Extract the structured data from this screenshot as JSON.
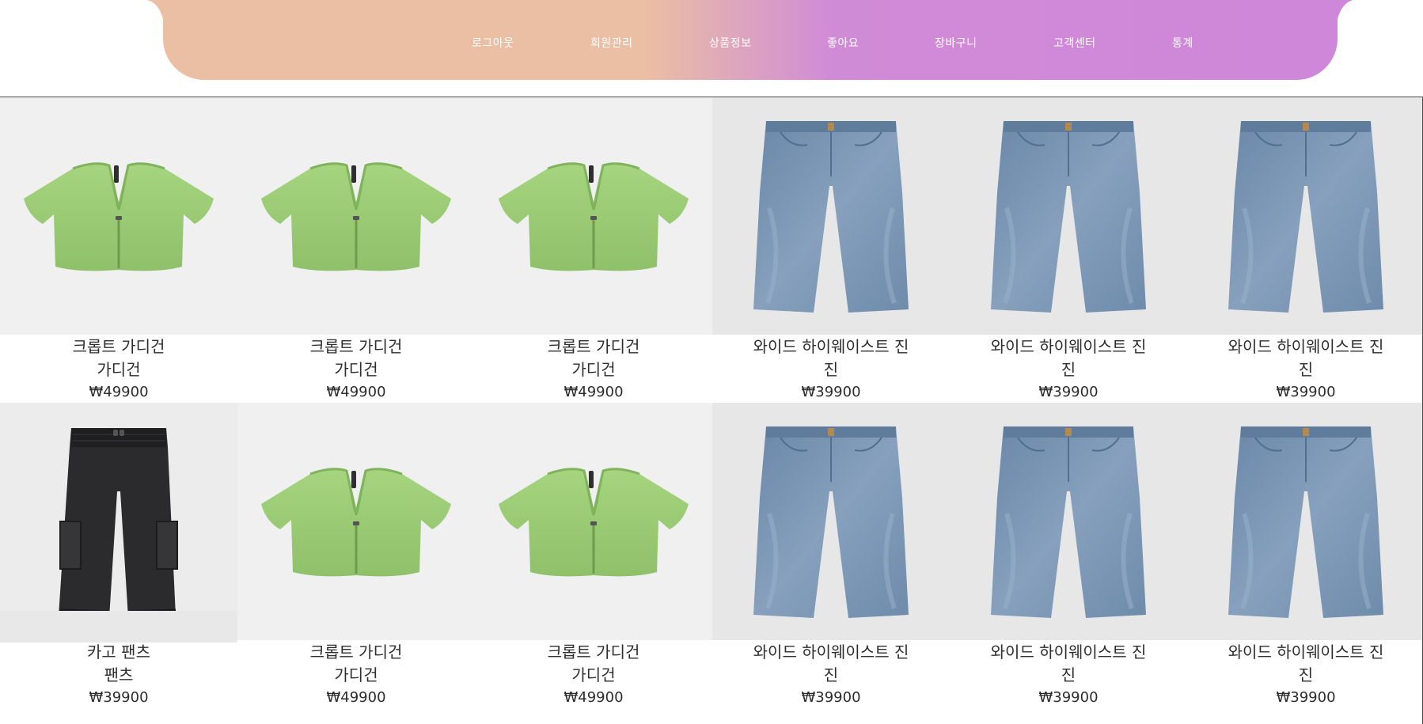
{
  "nav": {
    "items": [
      {
        "key": "logout",
        "label": "로그아웃"
      },
      {
        "key": "members",
        "label": "회원관리"
      },
      {
        "key": "products",
        "label": "상품정보"
      },
      {
        "key": "likes",
        "label": "좋아요"
      },
      {
        "key": "cart",
        "label": "장바구니"
      },
      {
        "key": "support",
        "label": "고객센터"
      },
      {
        "key": "stats",
        "label": "통계"
      }
    ]
  },
  "products": [
    {
      "line1": "크롭트 가디건",
      "line2": "가디건",
      "price": "₩49900",
      "image": "green-cardigan",
      "bg": "#f0f0f0"
    },
    {
      "line1": "크롭트 가디건",
      "line2": "가디건",
      "price": "₩49900",
      "image": "green-cardigan",
      "bg": "#f0f0f0"
    },
    {
      "line1": "크롭트 가디건",
      "line2": "가디건",
      "price": "₩49900",
      "image": "green-cardigan",
      "bg": "#f0f0f0"
    },
    {
      "line1": "와이드 하이웨이스트 진",
      "line2": "진",
      "price": "₩39900",
      "image": "blue-wide-jeans",
      "bg": "#e7e7e7"
    },
    {
      "line1": "와이드 하이웨이스트 진",
      "line2": "진",
      "price": "₩39900",
      "image": "blue-wide-jeans",
      "bg": "#e7e7e7"
    },
    {
      "line1": "와이드 하이웨이스트 진",
      "line2": "진",
      "price": "₩39900",
      "image": "blue-wide-jeans",
      "bg": "#e7e7e7"
    },
    {
      "line1": "카고 팬츠",
      "line2": "팬츠",
      "price": "₩39900",
      "image": "black-cargo-pants",
      "bg": "#ececec"
    },
    {
      "line1": "크롭트 가디건",
      "line2": "가디건",
      "price": "₩49900",
      "image": "green-cardigan",
      "bg": "#f0f0f0"
    },
    {
      "line1": "크롭트 가디건",
      "line2": "가디건",
      "price": "₩49900",
      "image": "green-cardigan",
      "bg": "#f0f0f0"
    },
    {
      "line1": "와이드 하이웨이스트 진",
      "line2": "진",
      "price": "₩39900",
      "image": "blue-wide-jeans",
      "bg": "#e7e7e7"
    },
    {
      "line1": "와이드 하이웨이스트 진",
      "line2": "진",
      "price": "₩39900",
      "image": "blue-wide-jeans",
      "bg": "#e7e7e7"
    },
    {
      "line1": "와이드 하이웨이스트 진",
      "line2": "진",
      "price": "₩39900",
      "image": "blue-wide-jeans",
      "bg": "#e7e7e7"
    }
  ],
  "colors": {
    "header_peach": "#ebbfa4",
    "header_purple": "#cf87d9",
    "text": "#2d2d2d",
    "cardigan_green": "#9bcb74",
    "jeans_blue": "#7b96b2",
    "cargo_black": "#2a2a2c"
  }
}
